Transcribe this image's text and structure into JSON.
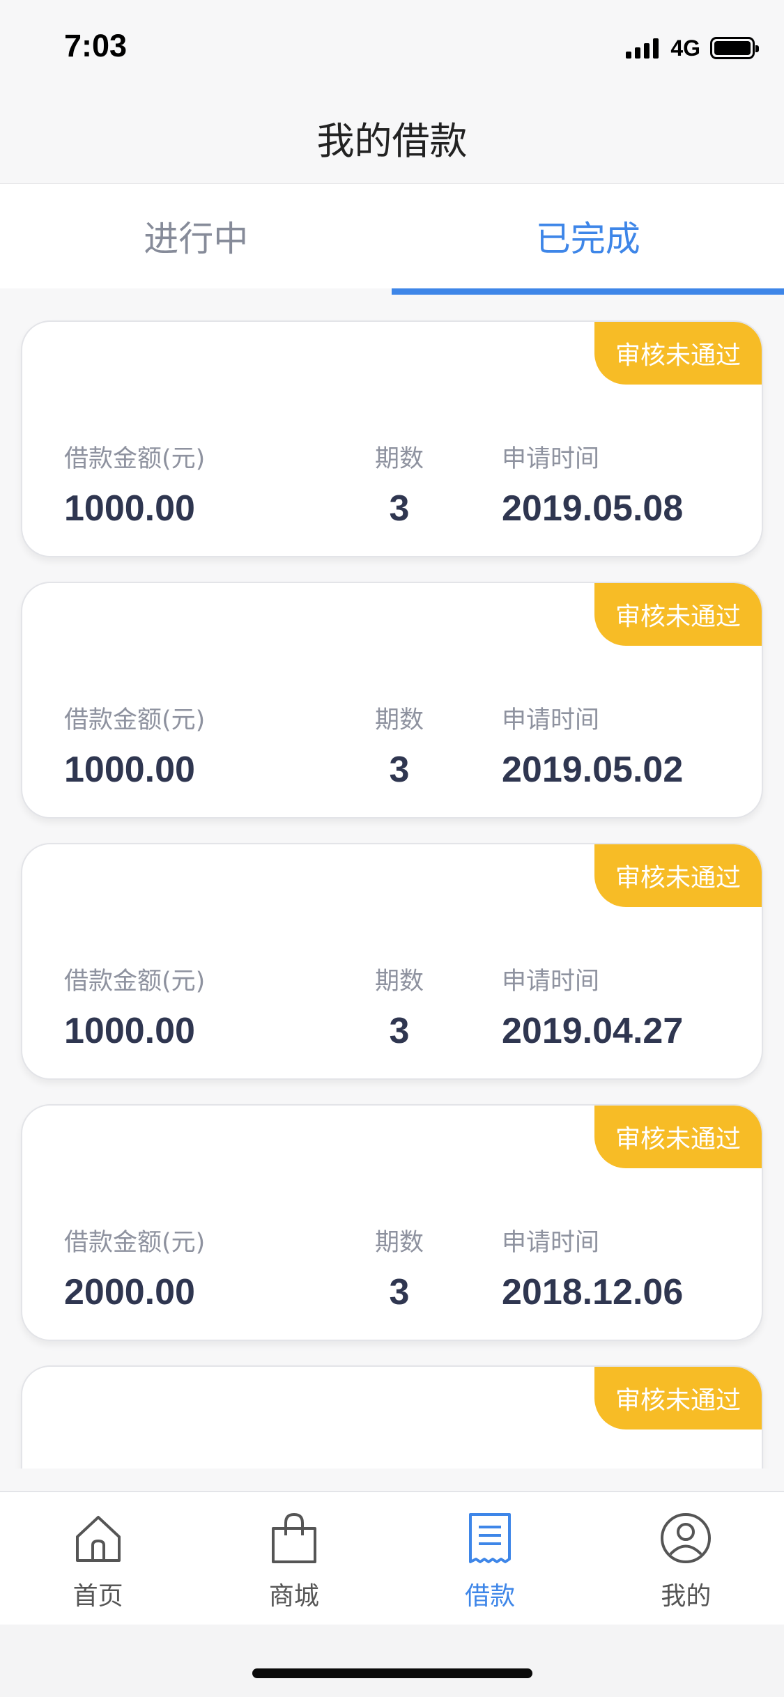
{
  "status_bar": {
    "time": "7:03",
    "network": "4G"
  },
  "nav": {
    "title": "我的借款"
  },
  "tabs": [
    {
      "label": "进行中",
      "active": false
    },
    {
      "label": "已完成",
      "active": true
    }
  ],
  "loans": [
    {
      "status": "审核未通过",
      "amount_label": "借款金额(元)",
      "amount": "1000.00",
      "periods_label": "期数",
      "periods": "3",
      "date_label": "申请时间",
      "date": "2019.05.08"
    },
    {
      "status": "审核未通过",
      "amount_label": "借款金额(元)",
      "amount": "1000.00",
      "periods_label": "期数",
      "periods": "3",
      "date_label": "申请时间",
      "date": "2019.05.02"
    },
    {
      "status": "审核未通过",
      "amount_label": "借款金额(元)",
      "amount": "1000.00",
      "periods_label": "期数",
      "periods": "3",
      "date_label": "申请时间",
      "date": "2019.04.27"
    },
    {
      "status": "审核未通过",
      "amount_label": "借款金额(元)",
      "amount": "2000.00",
      "periods_label": "期数",
      "periods": "3",
      "date_label": "申请时间",
      "date": "2018.12.06"
    },
    {
      "status": "审核未通过"
    }
  ],
  "bottom_tabs": [
    {
      "label": "首页",
      "icon": "home-icon",
      "active": false
    },
    {
      "label": "商城",
      "icon": "shopping-bag-icon",
      "active": false
    },
    {
      "label": "借款",
      "icon": "receipt-icon",
      "active": true
    },
    {
      "label": "我的",
      "icon": "user-icon",
      "active": false
    }
  ],
  "colors": {
    "accent": "#3e86e8",
    "badge": "#f7bc26",
    "value_text": "#2f3650",
    "label_text": "#8e929f"
  }
}
